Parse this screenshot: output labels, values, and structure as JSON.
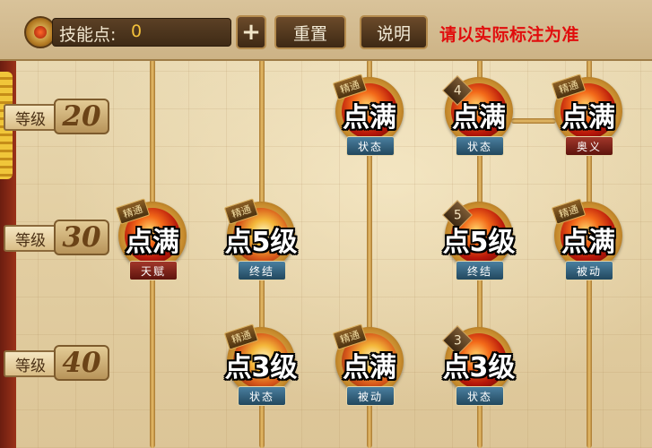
{
  "header": {
    "skill_points_label": "技能点:",
    "skill_points_value": "0",
    "plus_label": "+",
    "reset_label": "重置",
    "info_label": "说明",
    "note": "请以实际标注为准"
  },
  "levels": [
    {
      "tag": "等级",
      "value": "20"
    },
    {
      "tag": "等级",
      "value": "30"
    },
    {
      "tag": "等级",
      "value": "40"
    }
  ],
  "nodes": [
    {
      "id": "r20c3",
      "badge": "精通",
      "rank": "",
      "type": "状态",
      "type_color": "blue",
      "overlay": "点满"
    },
    {
      "id": "r20c4",
      "badge": "",
      "rank": "4",
      "type": "状态",
      "type_color": "blue",
      "overlay": "点满"
    },
    {
      "id": "r20c5",
      "badge": "精通",
      "rank": "",
      "type": "奥义",
      "type_color": "red",
      "overlay": "点满"
    },
    {
      "id": "r30c0",
      "badge": "精通",
      "rank": "",
      "type": "天赋",
      "type_color": "red",
      "overlay": "点满"
    },
    {
      "id": "r30c1",
      "badge": "精通",
      "rank": "",
      "type": "终结",
      "type_color": "blue",
      "overlay": "点5级"
    },
    {
      "id": "r30c4",
      "badge": "",
      "rank": "5",
      "type": "终结",
      "type_color": "blue",
      "overlay": "点5级"
    },
    {
      "id": "r30c5",
      "badge": "精通",
      "rank": "",
      "type": "被动",
      "type_color": "blue",
      "overlay": "点满"
    },
    {
      "id": "r40c1",
      "badge": "精通",
      "rank": "",
      "type": "状态",
      "type_color": "blue",
      "overlay": "点3级"
    },
    {
      "id": "r40c3",
      "badge": "精通",
      "rank": "",
      "type": "被动",
      "type_color": "blue",
      "overlay": "点满"
    },
    {
      "id": "r40c4",
      "badge": "",
      "rank": "3",
      "type": "状态",
      "type_color": "blue",
      "overlay": "点3级"
    }
  ]
}
